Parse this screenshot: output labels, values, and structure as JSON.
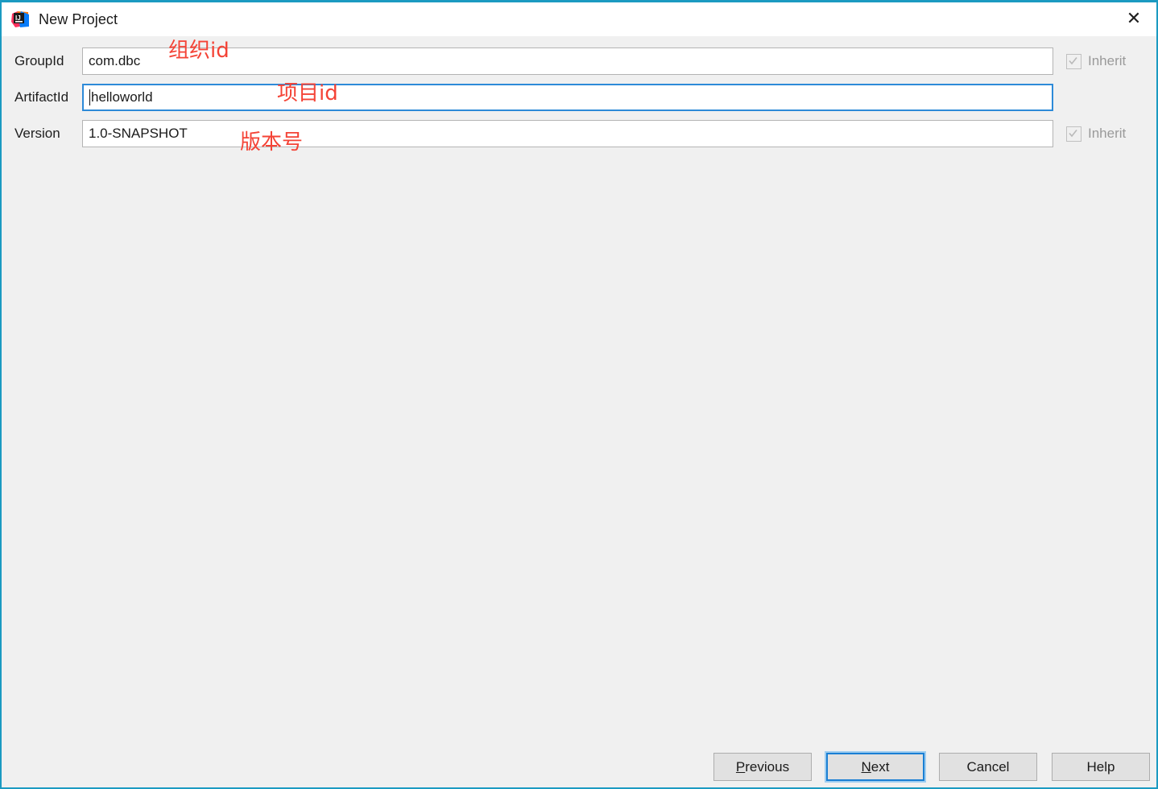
{
  "window": {
    "title": "New Project",
    "icon": "intellij-idea-logo",
    "close_label": "✕",
    "border_color": "#1b9ac1",
    "background": "#f0f0f0"
  },
  "form": {
    "rows": [
      {
        "label": "GroupId",
        "value": "com.dbc",
        "focused": false,
        "inherit": {
          "label": "Inherit",
          "checked": true,
          "enabled": false
        }
      },
      {
        "label": "ArtifactId",
        "value": "helloworld",
        "focused": true,
        "inherit": null
      },
      {
        "label": "Version",
        "value": "1.0-SNAPSHOT",
        "focused": false,
        "inherit": {
          "label": "Inherit",
          "checked": true,
          "enabled": false
        }
      }
    ]
  },
  "annotations": {
    "color": "#f44336",
    "group": "组织id",
    "artifact": "项目id",
    "version": "版本号"
  },
  "footer": {
    "buttons": [
      {
        "label": "Previous",
        "mnemonic": "P",
        "default": false
      },
      {
        "label": "Next",
        "mnemonic": "N",
        "default": true
      },
      {
        "label": "Cancel",
        "mnemonic": "",
        "default": false
      },
      {
        "label": "Help",
        "mnemonic": "",
        "default": false
      }
    ]
  }
}
